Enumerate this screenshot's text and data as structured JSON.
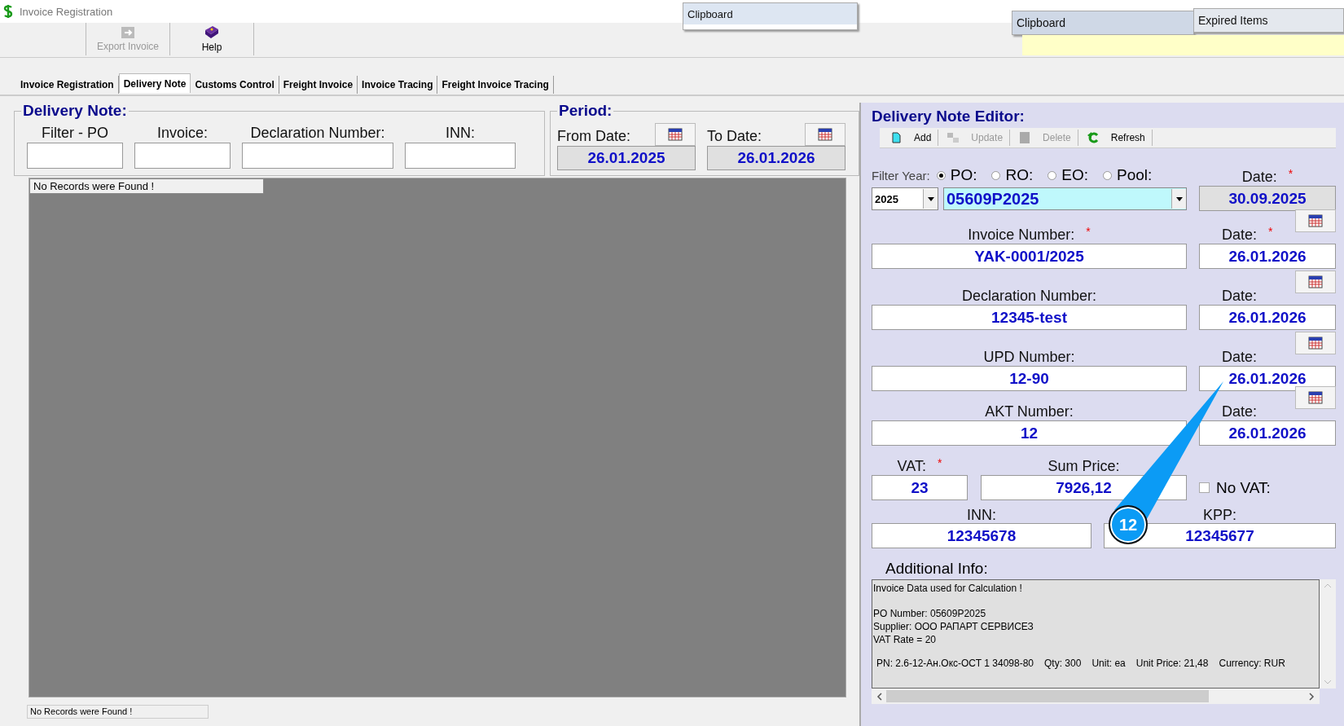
{
  "window": {
    "title": "Invoice Registration"
  },
  "popups": [
    {
      "label": "Clipboard",
      "kind": "menu"
    },
    {
      "label": "Clipboard",
      "kind": "menu"
    },
    {
      "label": "Expired Items",
      "kind": "menu"
    }
  ],
  "toolbar": [
    {
      "label": "Export Invoice",
      "disabled": true,
      "kind": "export"
    },
    {
      "label": "Help",
      "disabled": false,
      "kind": "help"
    }
  ],
  "tabs": [
    {
      "label": "Invoice Registration",
      "selected": false
    },
    {
      "label": "Delivery Note",
      "selected": true
    },
    {
      "label": "Customs Control",
      "selected": false
    },
    {
      "label": "Freight Invoice",
      "selected": false
    },
    {
      "label": "Invoice Tracing",
      "selected": false
    },
    {
      "label": "Freight Invoice Tracing",
      "selected": false
    }
  ],
  "filters": {
    "title": "Delivery Note:",
    "fields": [
      {
        "label": "Filter - PO",
        "kind": "po"
      },
      {
        "label": "Invoice:",
        "kind": "invoice"
      },
      {
        "label": "Declaration Number:",
        "kind": "declaration"
      },
      {
        "label": "INN:",
        "kind": "inn"
      }
    ]
  },
  "period": {
    "title": "Period:",
    "dates": [
      {
        "label": "From Date:",
        "value": "26.01.2025"
      },
      {
        "label": "To Date:",
        "value": "26.01.2026"
      }
    ]
  },
  "grid": {
    "message": "No Records were Found !"
  },
  "status": "No Records were Found !",
  "editor": {
    "title": "Delivery Note Editor:",
    "actions": [
      {
        "label": "Add",
        "disabled": false,
        "kind": "add"
      },
      {
        "label": "Update",
        "disabled": true,
        "kind": "update"
      },
      {
        "label": "Delete",
        "disabled": true,
        "kind": "delete"
      },
      {
        "label": "Refresh",
        "disabled": false,
        "kind": "refresh"
      }
    ],
    "filter_year_label": "Filter Year:",
    "year": "2025",
    "order_types": [
      {
        "label": "PO:",
        "selected": true
      },
      {
        "label": "RO:",
        "selected": false
      },
      {
        "label": "EO:",
        "selected": false
      },
      {
        "label": "Pool:",
        "selected": false
      }
    ],
    "order_number": "05609P2025",
    "order_date": {
      "label": "Date:",
      "required_mark": "*",
      "value": "30.09.2025"
    },
    "documents": [
      {
        "label": "Invoice Number:",
        "required_mark": "*",
        "value": "YAK-0001/2025",
        "date_label": "Date:",
        "date_required_mark": "*",
        "date": "26.01.2026"
      },
      {
        "label": "Declaration Number:",
        "value": "12345-test",
        "date_label": "Date:",
        "date": "26.01.2026"
      },
      {
        "label": "UPD Number:",
        "value": "12-90",
        "date_label": "Date:",
        "date": "26.01.2026"
      },
      {
        "label": "AKT Number:",
        "value": "12",
        "date_label": "Date:",
        "date": "26.01.2026"
      }
    ],
    "vat": {
      "label": "VAT:",
      "required_mark": "*",
      "value": "23"
    },
    "sum_price": {
      "label": "Sum Price:",
      "value": "7926,12"
    },
    "no_vat": {
      "label": "No VAT:",
      "checked": false
    },
    "inn": {
      "label": "INN:",
      "value": "12345678"
    },
    "kpp": {
      "label": "KPP:",
      "value": "12345677"
    },
    "additional_info": {
      "label": "Additional Info:",
      "blocks": [
        [
          "Invoice Data used for Calculation !"
        ],
        [
          "PO Number: 05609P2025",
          "Supplier: ООО РАПАРТ СЕРВИСЕЗ",
          "VAT Rate = 20"
        ]
      ],
      "item_fields": [
        "PN: 2.6-12-Ан.Окс-ОСТ 1 34098-80",
        "Qty: 300",
        "Unit: ea",
        "Unit Price: 21,48",
        "Currency: RUR"
      ]
    }
  },
  "callout": {
    "text": "12"
  }
}
